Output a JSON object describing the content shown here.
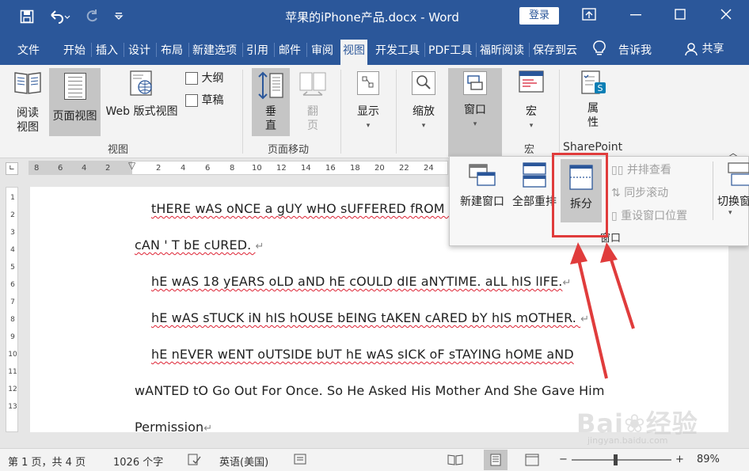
{
  "titlebar": {
    "title": "苹果的iPhone产品.docx  -  Word",
    "login_label": "登录",
    "save_icon": "save-icon",
    "undo_icon": "undo-icon",
    "redo_icon": "redo-icon",
    "customize_icon": "customize-qat-icon"
  },
  "tabs": [
    "文件",
    "开始",
    "插入",
    "设计",
    "布局",
    "新建选项",
    "引用",
    "邮件",
    "审阅",
    "视图",
    "开发工具",
    "PDF工具",
    "福昕阅读",
    "保存到云"
  ],
  "active_tab": "视图",
  "tell_me": "告诉我",
  "share": "共享",
  "ribbon": {
    "read_mode": "阅读视图",
    "read_mode_1": "阅读",
    "read_mode_2": "视图",
    "print_layout": "页面视图",
    "web_layout": "Web 版式视图",
    "outline": "大纲",
    "draft": "草稿",
    "views_group": "视图",
    "vertical": "垂",
    "vertical_2": "直",
    "flip": "翻",
    "flip_2": "页",
    "page_move_group": "页面移动",
    "show": "显示",
    "zoom": "缩放",
    "window": "窗口",
    "macros": "宏",
    "macros_group": "宏",
    "properties": "属",
    "properties_2": "性",
    "sharepoint_group": "SharePoint"
  },
  "window_popup": {
    "new_window": "新建窗口",
    "arrange_all": "全部重排",
    "split": "拆分",
    "side_by_side": "并排查看",
    "sync_scroll": "同步滚动",
    "reset_position": "重设窗口位置",
    "switch_window": "切换窗",
    "group_label": "窗口"
  },
  "ruler_ticks": [
    "8",
    "6",
    "4",
    "2",
    "2",
    "4",
    "6",
    "8",
    "10",
    "12",
    "14",
    "16",
    "18",
    "20",
    "22",
    "24"
  ],
  "vruler_ticks": [
    "1",
    "2",
    "3",
    "4",
    "5",
    "6",
    "7",
    "8",
    "9",
    "10",
    "11",
    "12",
    "13"
  ],
  "document": {
    "line1": "tHERE wAS oNCE a gUY wHO sUFFERED fROM c",
    "line2": "cAN ' T bE cURED. ",
    "line3": "hE wAS 18 yEARS oLD aND hE cOULD dIE aNYTIME. aLL hIS lIFE.",
    "line4": "hE wAS sTUCK iN hIS hOUSE bEING tAKEN cARED bY hIS mOTHER. ",
    "line5": "hE nEVER wENT oUTSIDE bUT hE wAS sICK oF sTAYING hOME aND",
    "line6": "wANTED tO Go Out For Once. So He Asked His Mother And She Gave Him",
    "line7": "Permission"
  },
  "status": {
    "page": "第 1 页，共 4 页",
    "words": "1026 个字",
    "language": "英语(美国)",
    "zoom": "89%",
    "zoom_minus": "−",
    "zoom_plus": "+"
  },
  "zoom_percent": 89,
  "colors": {
    "accent": "#2b579a",
    "highlight": "#e03c3c"
  }
}
